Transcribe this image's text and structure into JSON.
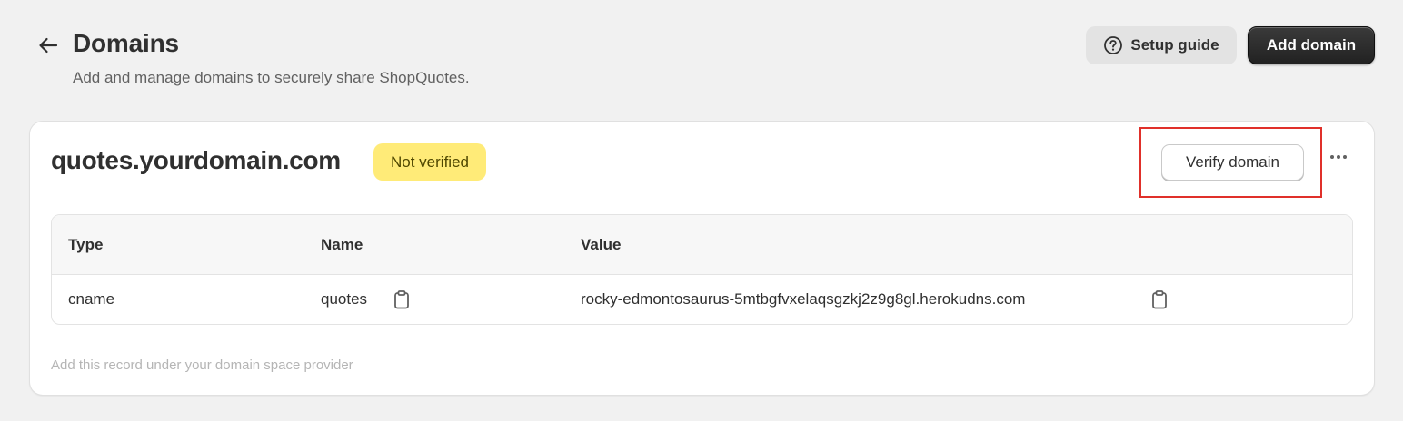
{
  "header": {
    "title": "Domains",
    "subtitle": "Add and manage domains to securely share ShopQuotes.",
    "setup_guide_label": "Setup guide",
    "add_domain_label": "Add domain"
  },
  "domain": {
    "name": "quotes.yourdomain.com",
    "status": "Not verified",
    "verify_label": "Verify domain"
  },
  "table": {
    "headers": {
      "type": "Type",
      "name": "Name",
      "value": "Value"
    },
    "rows": [
      {
        "type": "cname",
        "name": "quotes",
        "value": "rocky-edmontosaurus-5mtbgfvxelaqsgzkj2z9g8gl.herokudns.com"
      }
    ]
  },
  "helper_text": "Add this record under your domain space provider",
  "icons": {
    "back": "arrow-left-icon",
    "setup": "question-circle-icon",
    "more": "more-horizontal-icon",
    "copy": "clipboard-icon"
  },
  "colors": {
    "badge_bg": "#ffeb78",
    "primary_button": "#303030",
    "highlight": "#e0302a"
  }
}
